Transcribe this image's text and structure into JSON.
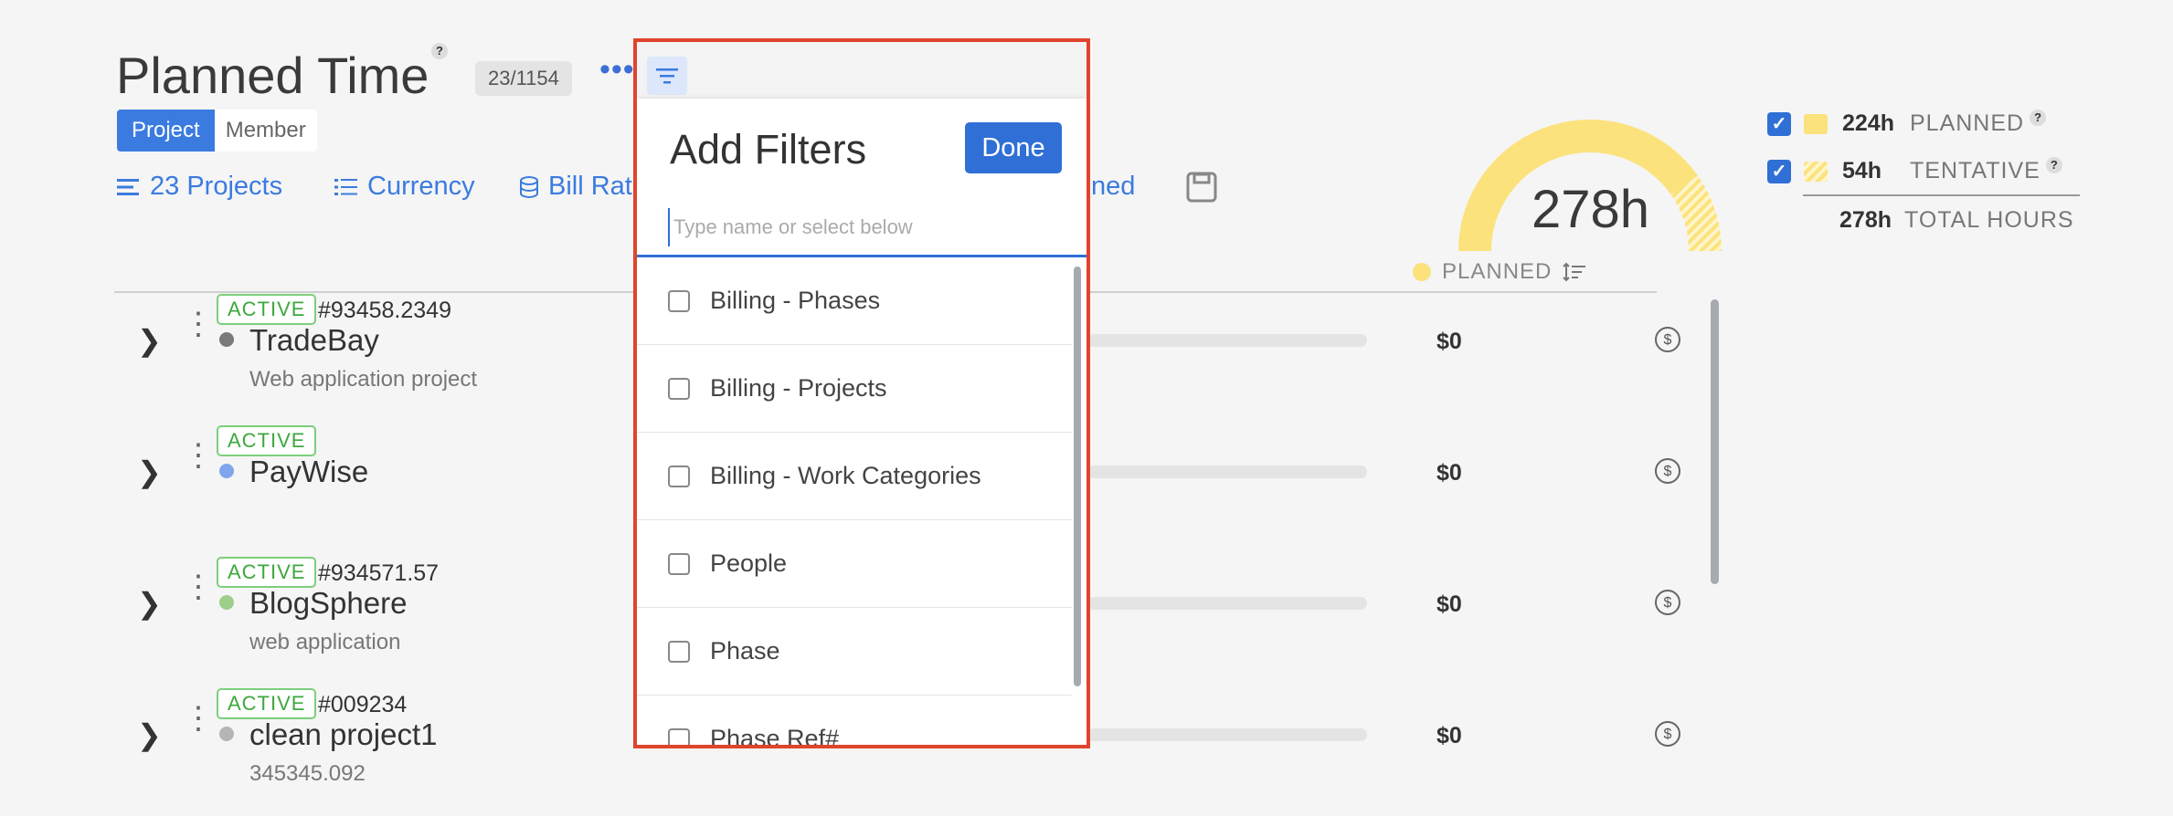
{
  "header": {
    "title": "Planned Time",
    "help": "?",
    "count": "23/1154",
    "more": "•••"
  },
  "view_toggle": {
    "project": "Project",
    "member": "Member"
  },
  "toolbar": {
    "projects": "23 Projects",
    "currency": "Currency",
    "bill_rate": "Bill Rat",
    "planned_tail": "ned"
  },
  "summary": {
    "total": "278h",
    "planned_value": "224h",
    "planned_label": "PLANNED",
    "tentative_value": "54h",
    "tentative_label": "TENTATIVE",
    "total_value": "278h",
    "total_label": "TOTAL HOURS",
    "planned_fraction": 0.806,
    "help": "?"
  },
  "column": {
    "planned": "PLANNED"
  },
  "projects": [
    {
      "status": "ACTIVE",
      "number": "#93458.2349",
      "name": "TradeBay",
      "desc": "Web application project",
      "amount": "$0",
      "color": "#7a7a7a"
    },
    {
      "status": "ACTIVE",
      "number": "",
      "name": "PayWise",
      "desc": "",
      "amount": "$0",
      "color": "#7fa6ec"
    },
    {
      "status": "ACTIVE",
      "number": "#934571.57",
      "name": "BlogSphere",
      "desc": "web application",
      "amount": "$0",
      "color": "#9ccf8a"
    },
    {
      "status": "ACTIVE",
      "number": "#009234",
      "name": "clean project1",
      "desc": "345345.092",
      "amount": "$0",
      "color": "#b5b5b5"
    }
  ],
  "filters": {
    "title": "Add Filters",
    "done": "Done",
    "placeholder": "Type name or select below",
    "options": [
      "Billing - Phases",
      "Billing - Projects",
      "Billing - Work Categories",
      "People",
      "Phase",
      "Phase Ref#"
    ]
  },
  "icons": {
    "expand": "chevron-right-icon",
    "menu": "kebab-icon",
    "dollar": "dollar-icon",
    "filter": "filter-icon",
    "save": "save-icon",
    "sort": "sort-icon"
  },
  "colors": {
    "accent": "#2f6fd6",
    "highlight": "#e0442c",
    "planned": "#fce27c",
    "active": "#3da83d"
  }
}
